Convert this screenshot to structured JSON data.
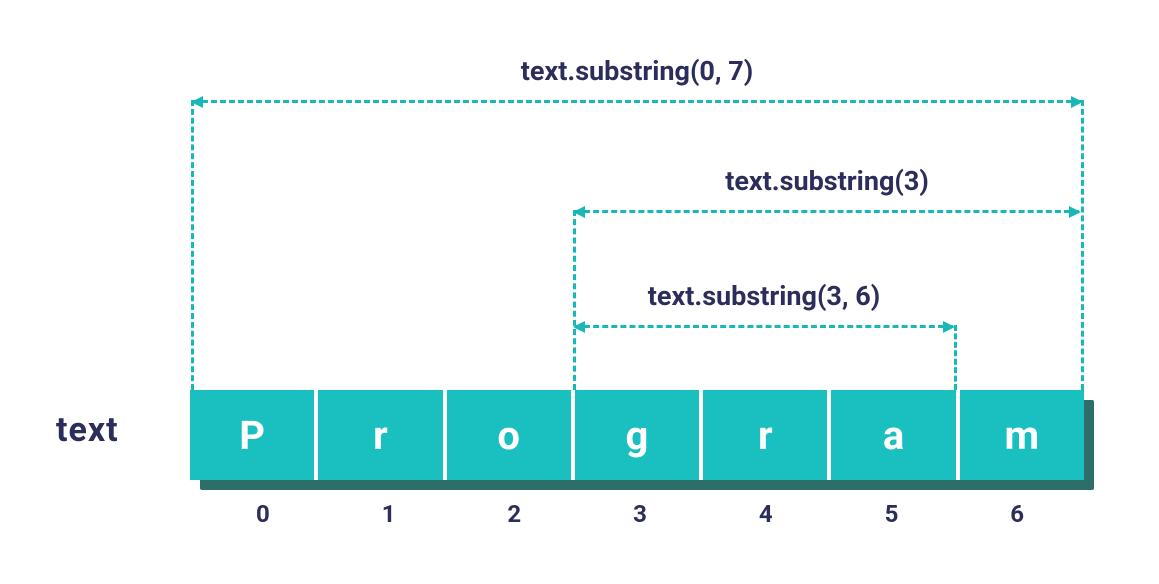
{
  "title": "text",
  "characters": [
    "P",
    "r",
    "o",
    "g",
    "r",
    "a",
    "m"
  ],
  "indices": [
    "0",
    "1",
    "2",
    "3",
    "4",
    "5",
    "6"
  ],
  "ranges": {
    "full": {
      "label": "text.substring(0, 7)",
      "start_index": 0,
      "end_index": 7
    },
    "from3": {
      "label": "text.substring(3)",
      "start_index": 3,
      "end_index": 7
    },
    "from3to6": {
      "label": "text.substring(3, 6)",
      "start_index": 3,
      "end_index": 6
    }
  },
  "colors": {
    "accent": "#18b8b8",
    "cell_bg": "#1abfbf",
    "shadow": "#2e6e6a",
    "text_dark": "#2b2d5b"
  }
}
